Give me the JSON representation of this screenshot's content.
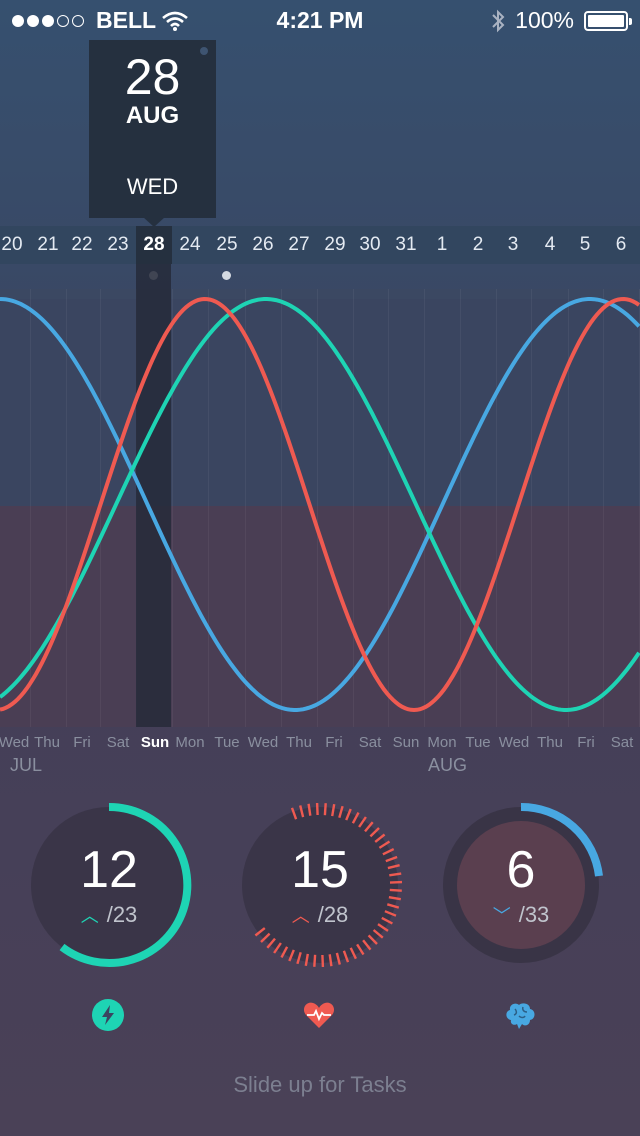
{
  "status_bar": {
    "carrier": "BELL",
    "time": "4:21 PM",
    "battery": "100%",
    "signal_bars": 5,
    "signal_filled": 3
  },
  "selected_date": {
    "day": "28",
    "month": "AUG",
    "weekday": "WED"
  },
  "date_strip": [
    "20",
    "21",
    "22",
    "23",
    "28",
    "24",
    "25",
    "26",
    "27",
    "29",
    "30",
    "31",
    "1",
    "2",
    "3",
    "4",
    "5",
    "6"
  ],
  "weekday_labels": [
    "Wed",
    "Thu",
    "Fri",
    "Sat",
    "Sun",
    "Mon",
    "Tue",
    "Wed",
    "Thu",
    "Fri",
    "Sat",
    "Sun",
    "Mon",
    "Tue",
    "Wed",
    "Thu",
    "Fri",
    "Sat"
  ],
  "month_labels": {
    "first": "JUL",
    "second": "AUG"
  },
  "colors": {
    "teal": "#1ed4b4",
    "red": "#ef5a51",
    "blue": "#48a8e2"
  },
  "stats": [
    {
      "value": "12",
      "total": "/23",
      "trend": "up",
      "icon": "lightning-bolt-icon",
      "color": "#1ed4b4"
    },
    {
      "value": "15",
      "total": "/28",
      "trend": "up",
      "icon": "heart-pulse-icon",
      "color": "#ef5a51"
    },
    {
      "value": "6",
      "total": "/33",
      "trend": "down",
      "icon": "brain-icon",
      "color": "#48a8e2"
    }
  ],
  "footer": "Slide up for Tasks"
}
